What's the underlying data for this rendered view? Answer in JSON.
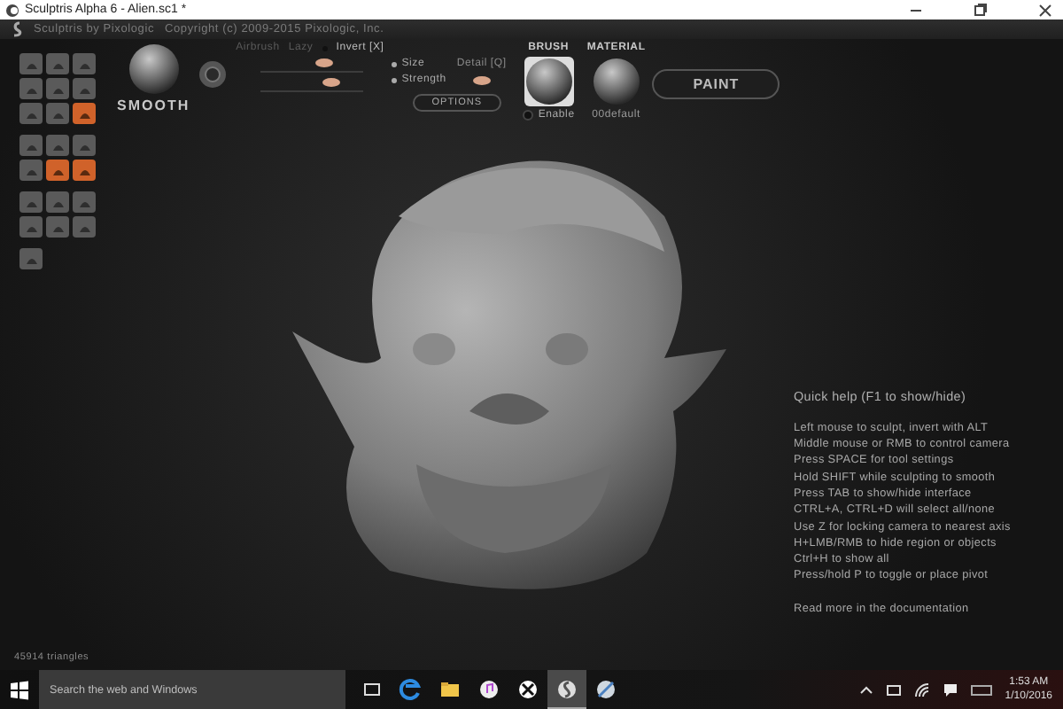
{
  "window": {
    "title": "Sculptris Alpha 6 - Alien.sc1 *"
  },
  "header": {
    "app_name": "Sculptris by Pixologic",
    "copyright": "Copyright (c) 2009-2015 Pixologic, Inc."
  },
  "palette": {
    "groups": [
      {
        "tools": [
          {
            "selected": false
          },
          {
            "selected": false
          },
          {
            "selected": false
          },
          {
            "selected": false
          },
          {
            "selected": false
          },
          {
            "selected": false
          },
          {
            "selected": false
          },
          {
            "selected": false
          },
          {
            "selected": true
          }
        ]
      },
      {
        "tools": [
          {
            "selected": false
          },
          {
            "selected": false
          },
          {
            "selected": false
          },
          {
            "selected": false
          },
          {
            "selected": true
          },
          {
            "selected": true
          }
        ]
      },
      {
        "tools": [
          {
            "selected": false
          },
          {
            "selected": false
          },
          {
            "selected": false
          },
          {
            "selected": false
          },
          {
            "selected": false
          },
          {
            "selected": false
          }
        ]
      },
      {
        "tools": [
          {
            "selected": false
          }
        ]
      }
    ]
  },
  "toolbar": {
    "brush_name": "SMOOTH",
    "toggles": [
      {
        "label": "Airbrush",
        "disabled": true
      },
      {
        "label": "Lazy",
        "disabled": true
      },
      {
        "label": "Invert [X]",
        "disabled": false
      }
    ],
    "sliders": [
      {
        "level": 0.62
      },
      {
        "level": 0.68
      }
    ],
    "targets": [
      {
        "label": "Size"
      },
      {
        "label": "Strength"
      }
    ],
    "detail": {
      "label": "Detail [Q]",
      "level": 0.5
    },
    "options_button": "OPTIONS",
    "brush": {
      "title": "BRUSH",
      "enable_label": "Enable",
      "checked": false
    },
    "material": {
      "title": "MATERIAL",
      "name": "00default"
    },
    "paint_button": "PAINT"
  },
  "quick_help": {
    "title": "Quick help (F1 to show/hide)",
    "lines": [
      "Left mouse to sculpt, invert with ALT",
      "Middle mouse or RMB to control camera",
      "Press SPACE for tool settings",
      "Hold SHIFT while sculpting to smooth",
      "Press TAB to show/hide interface",
      "CTRL+A, CTRL+D will select all/none",
      "Use Z for locking camera to nearest axis",
      "H+LMB/RMB to hide region or objects",
      "Ctrl+H to show all",
      "Press/hold P to toggle or place pivot"
    ],
    "link": "Read more in the documentation"
  },
  "status_bar": {
    "triangles": "45914 triangles"
  },
  "taskbar": {
    "search": {
      "placeholder": "Search the web and Windows"
    },
    "apps": [
      {
        "kind": "taskview",
        "selected": false
      },
      {
        "kind": "edge",
        "selected": false
      },
      {
        "kind": "folder",
        "selected": false
      },
      {
        "kind": "music",
        "selected": false
      },
      {
        "kind": "xbox",
        "selected": false
      },
      {
        "kind": "sculptris",
        "selected": true
      },
      {
        "kind": "paint",
        "selected": false
      }
    ],
    "time": "1:53 AM",
    "date": "1/10/2016"
  }
}
